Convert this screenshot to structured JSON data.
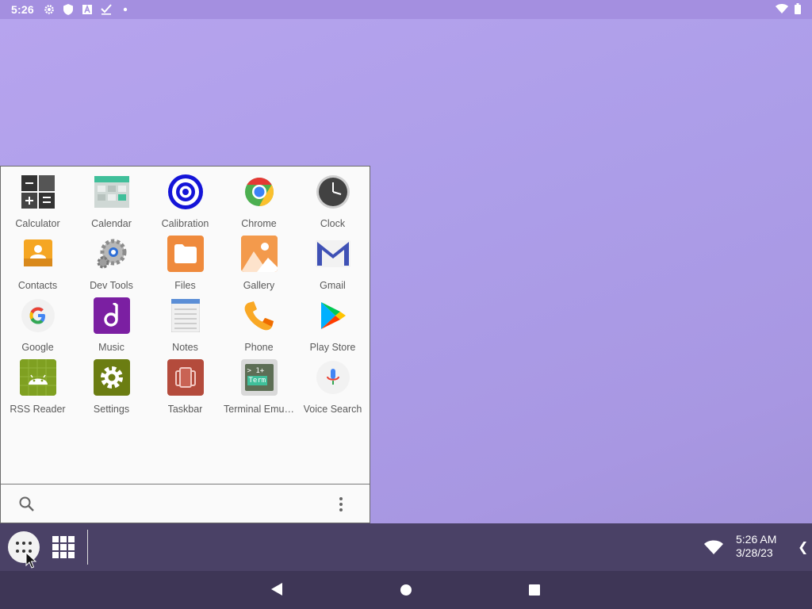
{
  "status_bar": {
    "time": "5:26",
    "icons": [
      "settings-icon",
      "shield-icon",
      "a-box-icon",
      "check-icon",
      "dot-icon"
    ],
    "right_icons": [
      "wifi-icon",
      "battery-icon"
    ]
  },
  "app_drawer": {
    "apps": [
      {
        "label": "Calculator",
        "icon": "calculator-icon"
      },
      {
        "label": "Calendar",
        "icon": "calendar-icon"
      },
      {
        "label": "Calibration",
        "icon": "calibration-icon"
      },
      {
        "label": "Chrome",
        "icon": "chrome-icon"
      },
      {
        "label": "Clock",
        "icon": "clock-icon"
      },
      {
        "label": "Contacts",
        "icon": "contacts-icon"
      },
      {
        "label": "Dev Tools",
        "icon": "dev-tools-icon"
      },
      {
        "label": "Files",
        "icon": "files-icon"
      },
      {
        "label": "Gallery",
        "icon": "gallery-icon"
      },
      {
        "label": "Gmail",
        "icon": "gmail-icon"
      },
      {
        "label": "Google",
        "icon": "google-icon"
      },
      {
        "label": "Music",
        "icon": "music-icon"
      },
      {
        "label": "Notes",
        "icon": "notes-icon"
      },
      {
        "label": "Phone",
        "icon": "phone-icon"
      },
      {
        "label": "Play Store",
        "icon": "play-store-icon"
      },
      {
        "label": "RSS Reader",
        "icon": "rss-reader-icon"
      },
      {
        "label": "Settings",
        "icon": "settings-icon"
      },
      {
        "label": "Taskbar",
        "icon": "taskbar-icon"
      },
      {
        "label": "Terminal Emu…",
        "icon": "terminal-icon"
      },
      {
        "label": "Voice Search",
        "icon": "voice-search-icon"
      }
    ],
    "search_icon": "search-icon",
    "menu_icon": "more-vert-icon"
  },
  "terminal_icon_text": {
    "line1": "> 1+",
    "line2": "Term"
  },
  "taskbar": {
    "time": "5:26 AM",
    "date": "3/28/23",
    "collapse_glyph": "❮"
  },
  "colors": {
    "wallpaper": "#ad9ee9",
    "taskbar": "#4a4166",
    "navbar": "#3e3656",
    "drawer": "#fafafa"
  }
}
